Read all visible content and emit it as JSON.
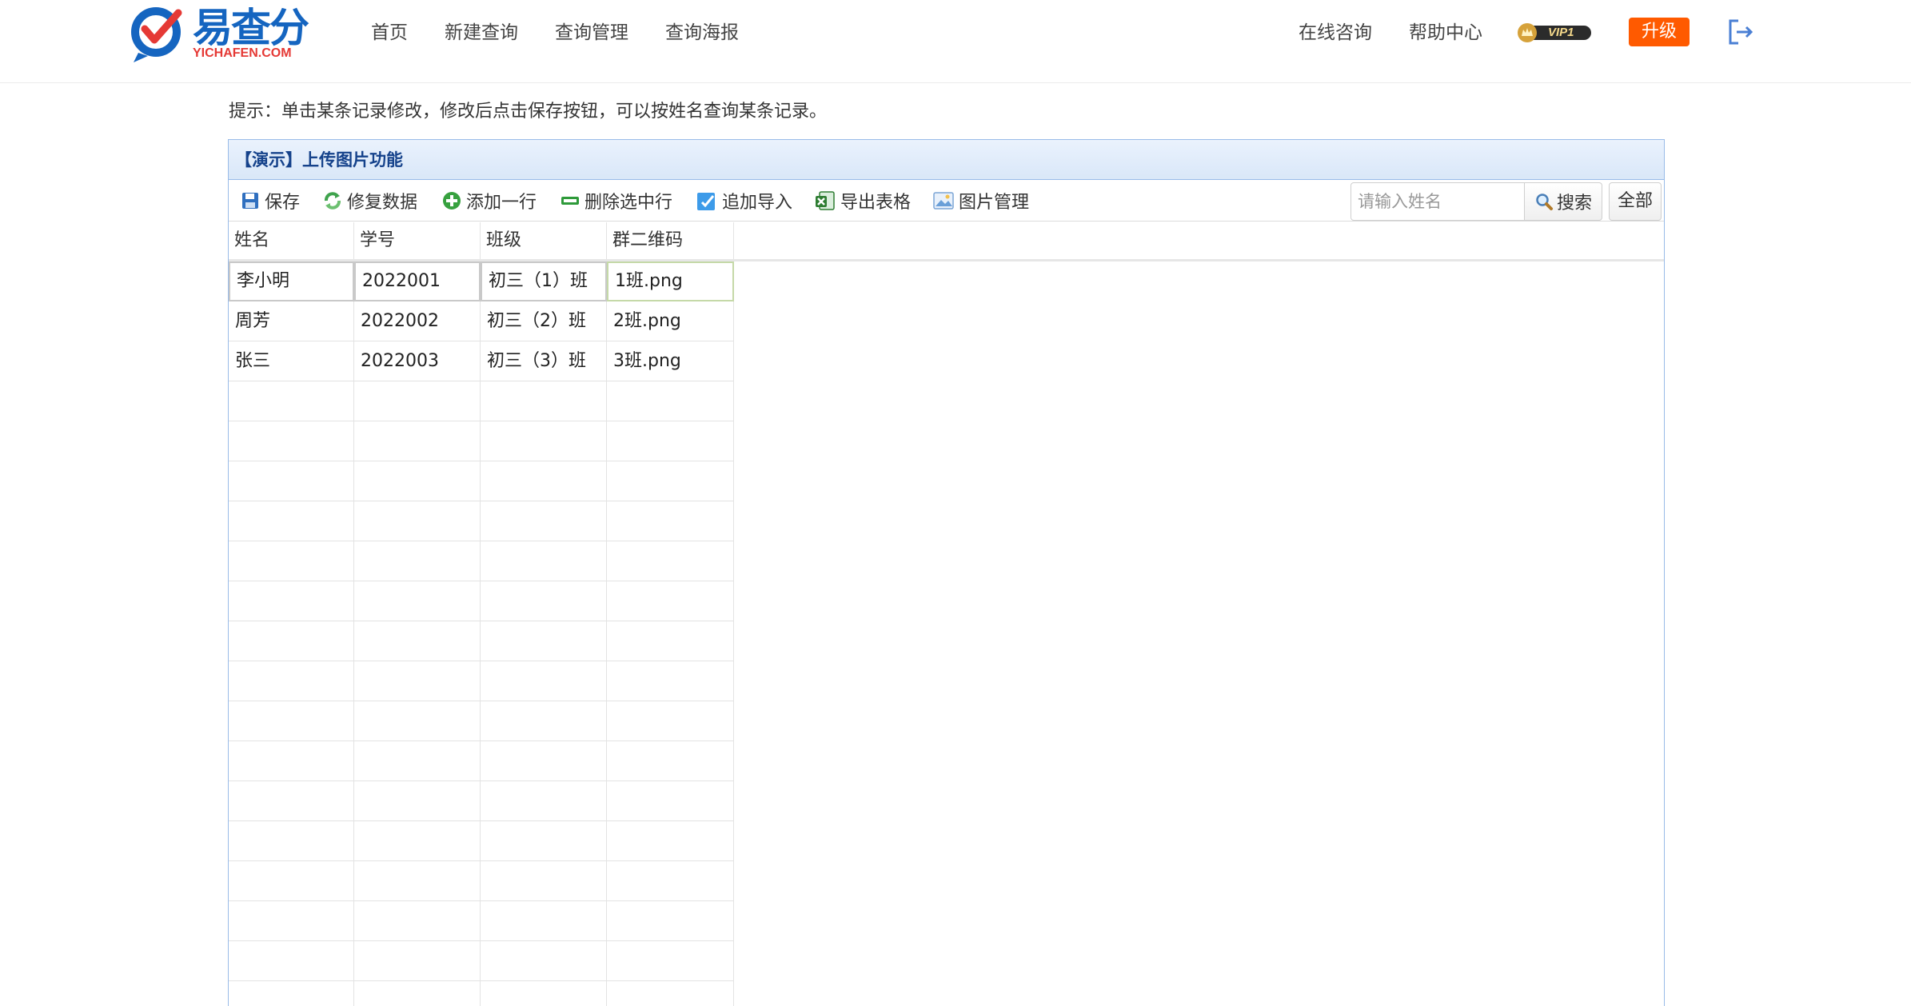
{
  "logo": {
    "brand": "易查分",
    "sub": "YICHAFEN.COM"
  },
  "nav": {
    "items": [
      "首页",
      "新建查询",
      "查询管理",
      "查询海报"
    ]
  },
  "nav_right": {
    "consult": "在线咨询",
    "help": "帮助中心",
    "vip": "VIP1",
    "upgrade": "升级"
  },
  "hint": "提示：单击某条记录修改，修改后点击保存按钮，可以按姓名查询某条记录。",
  "panel": {
    "title": "【演示】上传图片功能"
  },
  "toolbar": {
    "save": "保存",
    "repair": "修复数据",
    "add_row": "添加一行",
    "delete_row": "删除选中行",
    "append_import": "追加导入",
    "export": "导出表格",
    "image_manage": "图片管理",
    "search_placeholder": "请输入姓名",
    "search": "搜索",
    "all": "全部"
  },
  "table": {
    "columns": [
      "姓名",
      "学号",
      "班级",
      "群二维码"
    ],
    "rows": [
      [
        "李小明",
        "2022001",
        "初三（1）班",
        "1班.png"
      ],
      [
        "周芳",
        "2022002",
        "初三（2）班",
        "2班.png"
      ],
      [
        "张三",
        "2022003",
        "初三（3）班",
        "3班.png"
      ]
    ]
  },
  "colors": {
    "accent": "#1565c0",
    "upgrade": "#ff5a00",
    "panel_border": "#99bbe8",
    "panel_title": "#15428b"
  }
}
